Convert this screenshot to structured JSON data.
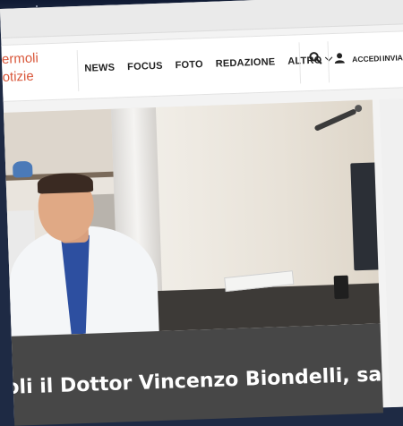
{
  "site": {
    "logo_line1": "ermoli",
    "logo_line2": "otizie"
  },
  "nav": {
    "items": [
      "NEWS",
      "FOCUS",
      "FOTO",
      "REDAZIONE"
    ],
    "more_label": "ALTRO"
  },
  "header_actions": {
    "search_icon": "search-icon",
    "user_icon": "user-icon",
    "login_label": "ACCEDI",
    "send_label": "INVIA A"
  },
  "article": {
    "headline": "noli il Dottor Vincenzo Biondelli, sarà"
  },
  "colors": {
    "brand": "#d9573a",
    "title_bg": "#474747"
  }
}
